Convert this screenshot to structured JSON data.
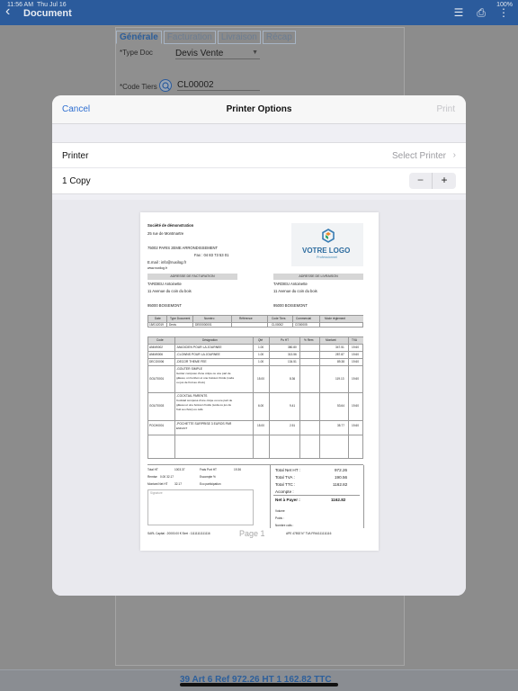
{
  "status_bar": {
    "time": "11:56 AM",
    "day": "Thu Jul 16",
    "battery": "100%"
  },
  "nav": {
    "title": "Document",
    "icons": [
      "list-icon",
      "printer-icon",
      "more-icon"
    ]
  },
  "form": {
    "tabs": [
      "Générale",
      "Facturation",
      "Livraison",
      "Récap"
    ],
    "type_doc_label": "*Type Doc",
    "type_doc_value": "Devis Vente",
    "code_tiers_label": "*Code Tiers",
    "code_tiers_value": "CL00002"
  },
  "footer": {
    "totals": "39 Art    6 Ref    972.26 HT    1 162.82 TTC"
  },
  "sheet": {
    "cancel": "Cancel",
    "title": "Printer Options",
    "print": "Print",
    "printer_label": "Printer",
    "printer_value": "Select Printer",
    "copies_label": "1 Copy",
    "minus": "−",
    "plus": "+",
    "page_label": "Page 1"
  },
  "document": {
    "company": "Société de démonstration",
    "street": "25 rue de Montmartre",
    "city": "75002   PARIS 2EME ARRONDISSEMENT",
    "fax": "Fax : 04 83 73 53 01",
    "email": "E.mail : info@nuxilog.fr",
    "web": "www.nuxilog.fr",
    "logo": "VOTRE LOGO",
    "logo_sub": "Professionnel",
    "billing_head": "ADRESSE DE FACTURATION",
    "delivery_head": "ADRESSE DE LIVRAISON",
    "billing_name": "TARDIEU Antoinette",
    "billing_street": "11 Avenue du coin du bois",
    "billing_city": "95000   BOISEMONT",
    "delivery_name": "TARDIEU Antoinette",
    "delivery_street": "11 Avenue du coin du bois",
    "delivery_city": "95000   BOISEMONT",
    "info_headers": [
      "Date",
      "Type Document",
      "Numéro",
      "Référence",
      "Code Tiers",
      "Commercial",
      "Mode règlement"
    ],
    "info_values": [
      "15/01/2019",
      "Devis",
      "DE00000001",
      "",
      "CL00002",
      "CO00005",
      ""
    ],
    "line_headers": [
      "Code",
      "Désignation",
      "Qté",
      "Pu HT",
      "% Rem",
      "Montant",
      "TVA"
    ],
    "lines": [
      {
        "code": "ANIM0002",
        "designation": "-MAGICIEN POUR LA JOURNEE",
        "qty": "1.00",
        "pu": "380.80",
        "rem": "",
        "montant": "347.51",
        "tva": "19.60"
      },
      {
        "code": "ANIM0006",
        "designation": "-CLOWNS POUR LA JOURNEE",
        "qty": "1.00",
        "pu": "313.56",
        "rem": "",
        "montant": "287.87",
        "tva": "19.60"
      },
      {
        "code": "DECO0006",
        "designation": "-DECOR THEME FEE",
        "qty": "1.00",
        "pu": "134.51",
        "rem": "",
        "montant": "89.38",
        "tva": "19.60"
      },
      {
        "code": "GOUT0001",
        "designation": "-GOUTER SIMPLE",
        "qty": "15.00",
        "pu": "8.36",
        "rem": "",
        "montant": "119.13",
        "tva": "19.60"
      },
      {
        "code": "GOUT0003",
        "designation": "-COCKTAIL PARENTS",
        "qty": "6.00",
        "pu": "9.41",
        "rem": "",
        "montant": "53.64",
        "tva": "19.60"
      },
      {
        "code": "POCH0001",
        "designation": "-POCHETTE SURPRISE 3 EUROS PAR",
        "qty": "15.00",
        "pu": "2.51",
        "rem": "",
        "montant": "35.77",
        "tva": "19.60"
      }
    ],
    "line_details": [
      "Goûter composé d'une crêpe ou une part de",
      "gâteau, un bonbon et une boisson froide (soda",
      "ou jus de fruit au choix)",
      "Cocktail composé d'une crêpe ou une part de",
      "gâteau et une boisson froide (soda ou jus de",
      "fruit au choix) ou café",
      "ENFANT"
    ],
    "totals_left": [
      {
        "label": "Total HT",
        "value": "1003.37"
      },
      {
        "label": "Remise",
        "value": "0.00  32.17"
      },
      {
        "label": "Montant Net HT",
        "value": "32.17"
      }
    ],
    "totals_mid": [
      "Frais Port HT",
      "Escompte %",
      "Eco participation"
    ],
    "frais_port": "19.36",
    "signature": "Signature",
    "total_net_ht_label": "Total Net HT :",
    "total_net_ht": "972.26",
    "total_tva_label": "Total TVA :",
    "total_tva": "190.56",
    "total_ttc_label": "Total TTC :",
    "total_ttc": "1162.82",
    "acompte_label": "Acompte :",
    "net_a_payer_label": "Net à Payer :",
    "net_a_payer": "1162.82",
    "volume_label": "Volume",
    "poids_label": "Poids :",
    "colis_label": "Nombre colis :",
    "footer_left": "SARL   Capital :         20000.00   €     Siret :    11111111111116",
    "footer_right": "APE   4789Z     N° TVA    FR44111111116"
  }
}
